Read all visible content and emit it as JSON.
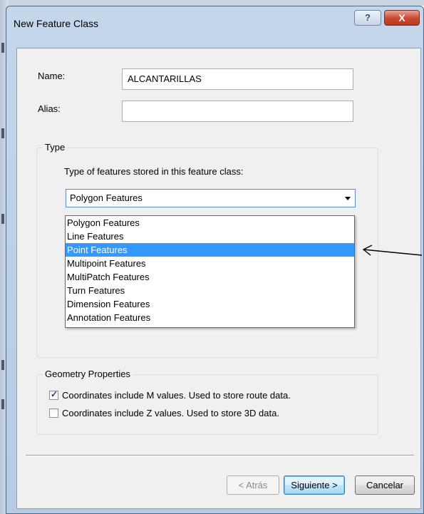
{
  "window": {
    "title": "New Feature Class",
    "help_glyph": "?",
    "close_glyph": "X"
  },
  "form": {
    "name_label": "Name:",
    "name_value": "ALCANTARILLAS",
    "alias_label": "Alias:",
    "alias_value": ""
  },
  "type_group": {
    "title": "Type",
    "prompt": "Type of features stored in this feature class:",
    "selected": "Polygon Features",
    "options": [
      "Polygon Features",
      "Line Features",
      "Point Features",
      "Multipoint Features",
      "MultiPatch Features",
      "Turn Features",
      "Dimension Features",
      "Annotation Features"
    ],
    "highlighted_index": 2
  },
  "geometry_group": {
    "title": "Geometry Properties",
    "m_values_label": "Coordinates include M values. Used to store route data.",
    "m_values_checked": true,
    "z_values_label": "Coordinates include Z values. Used to store 3D data.",
    "z_values_checked": false
  },
  "buttons": {
    "back": "< Atrás",
    "next": "Siguiente >",
    "cancel": "Cancelar"
  },
  "colors": {
    "highlight": "#3399ff",
    "title_bar": "#c4d6ea",
    "close_button": "#c8472f"
  }
}
